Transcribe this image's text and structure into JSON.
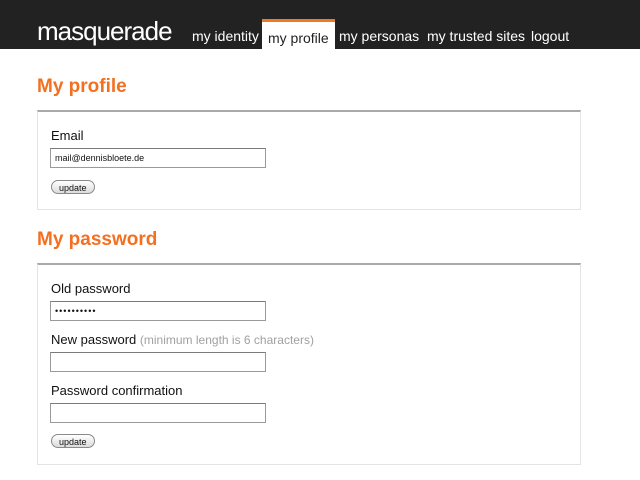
{
  "app": {
    "logo": "masquerade"
  },
  "nav": {
    "items": [
      {
        "label": "my identity",
        "active": false
      },
      {
        "label": "my profile",
        "active": true
      },
      {
        "label": "my personas",
        "active": false
      },
      {
        "label": "my trusted sites",
        "active": false
      },
      {
        "label": "logout",
        "active": false
      }
    ]
  },
  "profile": {
    "title": "My profile",
    "email_label": "Email",
    "email_value": "mail@dennisbloete.de",
    "update_label": "update"
  },
  "password": {
    "title": "My password",
    "old_label": "Old password",
    "old_value": "••••••••••",
    "new_label": "New password",
    "new_hint": "(minimum length is 6 characters)",
    "new_value": "",
    "confirm_label": "Password confirmation",
    "confirm_value": "",
    "update_label": "update"
  },
  "colors": {
    "accent": "#f37021",
    "topbar": "#222222",
    "active_tab_border": "#f07a22"
  }
}
